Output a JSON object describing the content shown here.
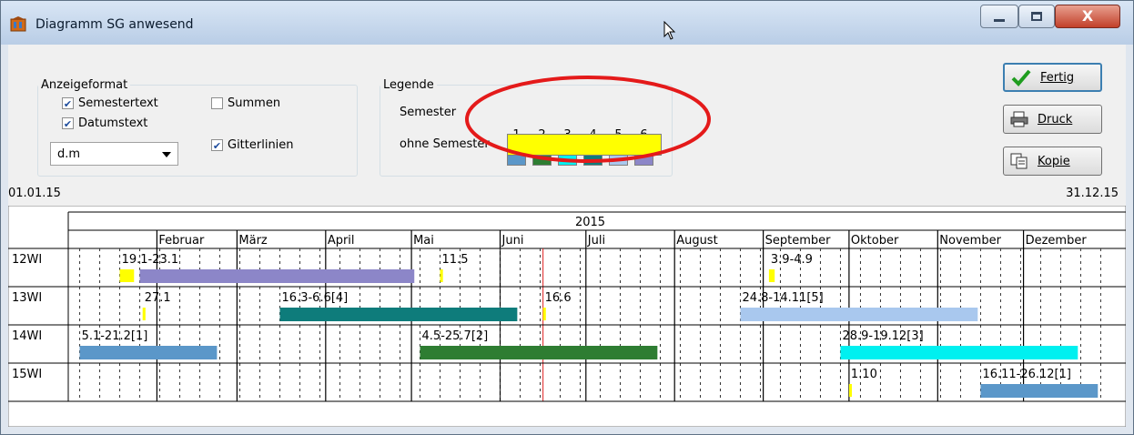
{
  "window": {
    "title": "Diagramm SG anwesend",
    "close_label": "X"
  },
  "display_format": {
    "legend": "Anzeigeformat",
    "semestertext": {
      "label": "Semestertext",
      "checked": true
    },
    "datumstext": {
      "label": "Datumstext",
      "checked": true
    },
    "summen": {
      "label": "Summen",
      "checked": false
    },
    "gitterlinien": {
      "label": "Gitterlinien",
      "checked": true
    },
    "date_format": "d.m"
  },
  "legend": {
    "title": "Legende",
    "semester_label": "Semester",
    "ohne_label": "ohne Semester",
    "semesters": [
      {
        "num": "1",
        "color": "#5b97c9"
      },
      {
        "num": "2",
        "color": "#2e7d32"
      },
      {
        "num": "3",
        "color": "#00f0f0"
      },
      {
        "num": "4",
        "color": "#0e7c7b"
      },
      {
        "num": "5",
        "color": "#a9c8ee"
      },
      {
        "num": "6",
        "color": "#8c86c8"
      }
    ],
    "ohne_color": "#ffff00"
  },
  "buttons": {
    "fertig": "Fertig",
    "druck": "Druck",
    "kopie": "Kopie"
  },
  "date_range": {
    "start": "01.01.15",
    "end": "31.12.15"
  },
  "chart_data": {
    "type": "gantt",
    "year": "2015",
    "months": [
      "Februar",
      "März",
      "April",
      "Mai",
      "Juni",
      "Juli",
      "August",
      "September",
      "Oktober",
      "November",
      "Dezember"
    ],
    "rows": [
      {
        "name": "12WI",
        "bars": [
          {
            "label": "19.1-23.1",
            "start": "01-19",
            "end": "01-23",
            "color": "#ffff00"
          },
          {
            "label": "",
            "start": "01-26",
            "end": "05-01",
            "color": "#8c86c8"
          },
          {
            "label": "11.5",
            "start": "05-11",
            "end": "05-11",
            "color": "#ffff00"
          },
          {
            "label": "3.9-4.9",
            "start": "09-03",
            "end": "09-04",
            "color": "#ffff00"
          }
        ]
      },
      {
        "name": "13WI",
        "bars": [
          {
            "label": "27.1",
            "start": "01-27",
            "end": "01-27",
            "color": "#ffff00"
          },
          {
            "label": "16.3-6.6[4]",
            "start": "03-16",
            "end": "06-06",
            "color": "#0e7c7b"
          },
          {
            "label": "16.6",
            "start": "06-16",
            "end": "06-16",
            "color": "#ffff00"
          },
          {
            "label": "24.8-14.11[5]",
            "start": "08-24",
            "end": "11-14",
            "color": "#a9c8ee"
          }
        ]
      },
      {
        "name": "14WI",
        "bars": [
          {
            "label": "5.1-21.2[1]",
            "start": "01-05",
            "end": "02-21",
            "color": "#5b97c9"
          },
          {
            "label": "4.5-25.7[2]",
            "start": "05-04",
            "end": "07-25",
            "color": "#2e7d32"
          },
          {
            "label": "28.9-19.12[3]",
            "start": "09-28",
            "end": "12-19",
            "color": "#00f0f0"
          }
        ]
      },
      {
        "name": "15WI",
        "bars": [
          {
            "label": "1.10",
            "start": "10-01",
            "end": "10-01",
            "color": "#ffff00"
          },
          {
            "label": "16.11-26.12[1]",
            "start": "11-16",
            "end": "12-26",
            "color": "#5b97c9"
          }
        ]
      }
    ],
    "today": "06-16"
  }
}
